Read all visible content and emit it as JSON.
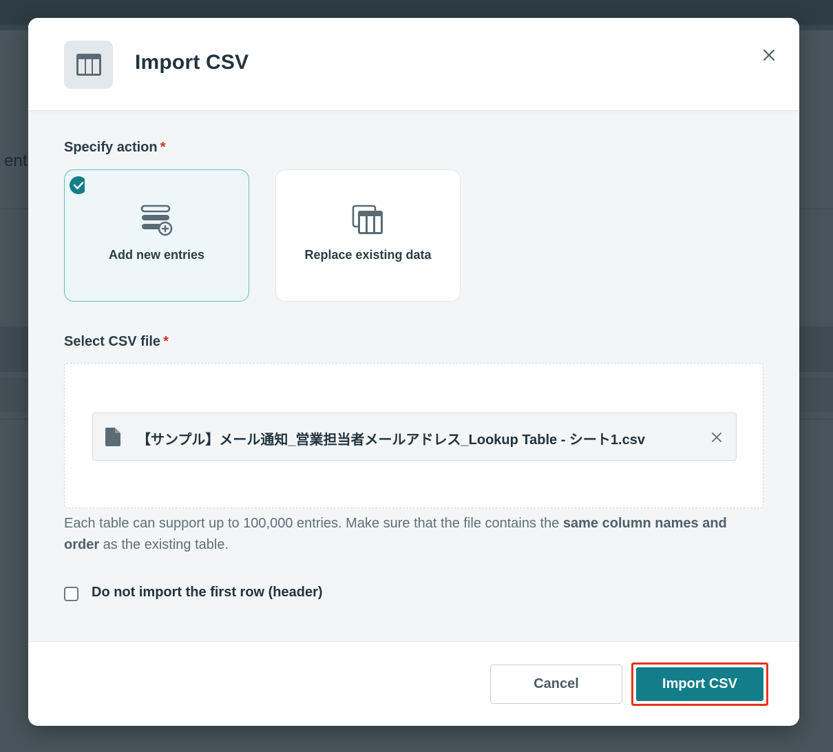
{
  "background": {
    "partial_text": "ent"
  },
  "modal": {
    "title": "Import CSV",
    "header_icon": "table-icon",
    "close_icon": "close-icon",
    "specify_action": {
      "label": "Specify action",
      "required_mark": "*",
      "options": [
        {
          "label": "Add new entries",
          "icon": "add-entries-icon",
          "selected": true
        },
        {
          "label": "Replace existing data",
          "icon": "replace-table-icon",
          "selected": false
        }
      ]
    },
    "select_file": {
      "label": "Select CSV file",
      "required_mark": "*",
      "file_name": "【サンプル】メール通知_営業担当者メールアドレス_Lookup Table - シート1.csv",
      "file_icon": "file-icon",
      "remove_icon": "close-icon"
    },
    "help": {
      "text_before": "Each table can support up to 100,000 entries. Make sure that the file contains the ",
      "bold": "same column names and order",
      "text_after": " as the existing table."
    },
    "skip_header": {
      "label": "Do not import the first row (header)",
      "checked": false
    },
    "footer": {
      "cancel_label": "Cancel",
      "import_label": "Import CSV"
    }
  },
  "colors": {
    "accent": "#137e8a",
    "selected_border": "#5fc3c7",
    "required": "#d0302a",
    "highlight_outline": "#e7321c"
  }
}
